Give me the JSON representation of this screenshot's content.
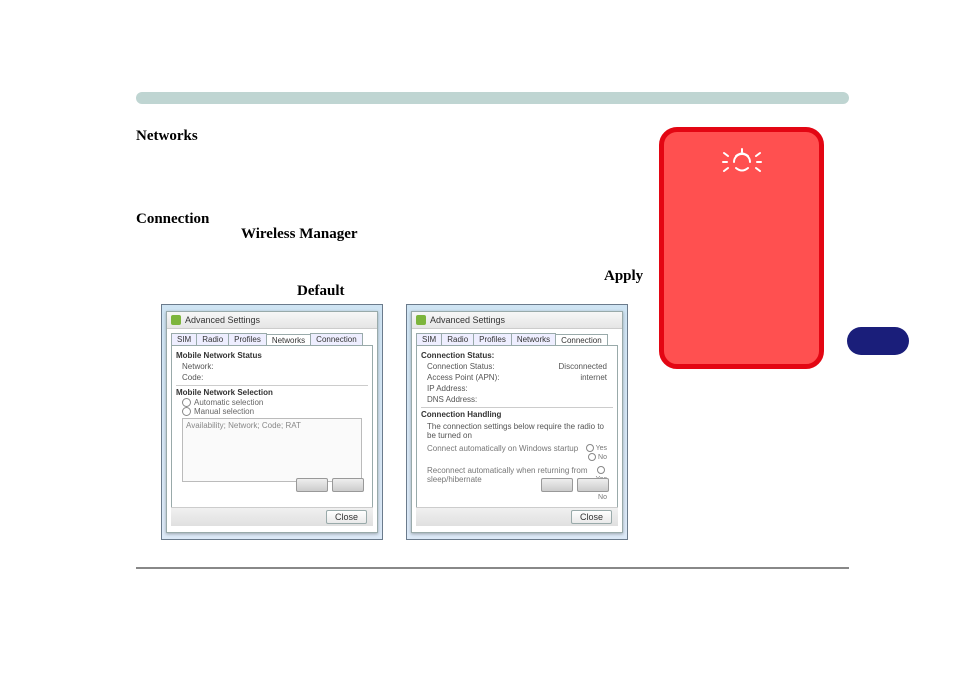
{
  "headings": {
    "networks": "Networks",
    "connection": "Connection",
    "wireless_manager": "Wireless Manager",
    "apply": "Apply",
    "default": "Default"
  },
  "warning": {
    "icon": "alarm-bell-icon"
  },
  "shot_left": {
    "window_title": "Advanced Settings",
    "tabs": [
      "SIM",
      "Radio",
      "Profiles",
      "Networks",
      "Connection"
    ],
    "active_tab": "Networks",
    "group1": "Mobile Network Status",
    "g1_rows": [
      {
        "k": "Network:",
        "v": ""
      },
      {
        "k": "Code:",
        "v": ""
      }
    ],
    "group2": "Mobile Network Selection",
    "radio_auto": "Automatic selection",
    "radio_manual": "Manual selection",
    "list_header": "Availability; Network; Code; RAT",
    "close": "Close"
  },
  "shot_right": {
    "window_title": "Advanced Settings",
    "tabs": [
      "SIM",
      "Radio",
      "Profiles",
      "Networks",
      "Connection"
    ],
    "active_tab": "Connection",
    "group1": "Connection Status:",
    "g1_rows": [
      {
        "k": "Connection Status:",
        "v": "Disconnected"
      },
      {
        "k": "Access Point (APN):",
        "v": "internet"
      },
      {
        "k": "IP Address:",
        "v": ""
      },
      {
        "k": "DNS Address:",
        "v": ""
      }
    ],
    "group2": "Connection Handling",
    "note": "The connection settings below require the radio to be turned on",
    "opt1": "Connect automatically on Windows startup",
    "opt2": "Reconnect automatically when returning from sleep/hibernate",
    "yes": "Yes",
    "no": "No",
    "close": "Close"
  }
}
